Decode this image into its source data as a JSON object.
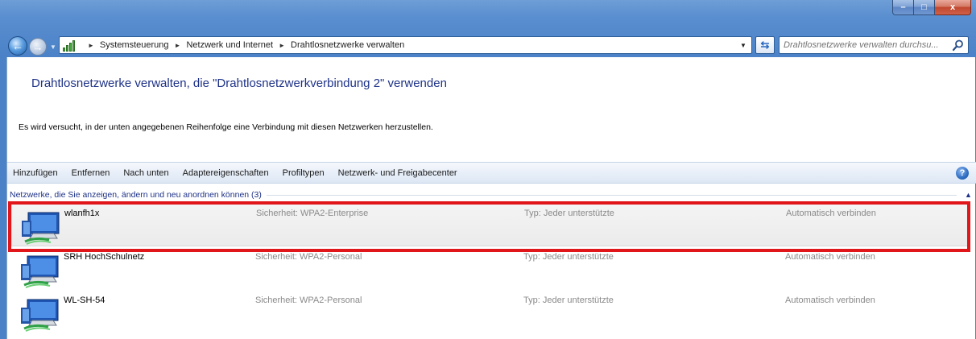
{
  "window": {
    "caption_buttons": {
      "minimize": "–",
      "maximize": "□",
      "close": "x"
    }
  },
  "navigation": {
    "breadcrumbs": [
      "Systemsteuerung",
      "Netzwerk und Internet",
      "Drahtlosnetzwerke verwalten"
    ],
    "search_placeholder": "Drahtlosnetzwerke verwalten durchsu..."
  },
  "main": {
    "title": "Drahtlosnetzwerke verwalten, die \"Drahtlosnetzwerkverbindung 2\" verwenden",
    "description": "Es wird versucht, in der unten angegebenen Reihenfolge eine Verbindung mit diesen Netzwerken herzustellen."
  },
  "toolbar": {
    "items": [
      "Hinzufügen",
      "Entfernen",
      "Nach unten",
      "Adaptereigenschaften",
      "Profiltypen",
      "Netzwerk- und Freigabecenter"
    ]
  },
  "group": {
    "label": "Netzwerke, die Sie anzeigen, ändern und neu anordnen können (3)"
  },
  "networks": [
    {
      "name": "wlanfh1x",
      "security": "Sicherheit: WPA2-Enterprise",
      "type": "Typ: Jeder unterstützte",
      "mode": "Automatisch verbinden",
      "selected": true
    },
    {
      "name": "SRH HochSchulnetz",
      "security": "Sicherheit: WPA2-Personal",
      "type": "Typ: Jeder unterstützte",
      "mode": "Automatisch verbinden",
      "selected": false
    },
    {
      "name": "WL-SH-54",
      "security": "Sicherheit: WPA2-Personal",
      "type": "Typ: Jeder unterstützte",
      "mode": "Automatisch verbinden",
      "selected": false
    }
  ],
  "colors": {
    "title_blue": "#1e3287",
    "highlight_red": "#e0161a",
    "window_blue": "#5a8fd0"
  }
}
